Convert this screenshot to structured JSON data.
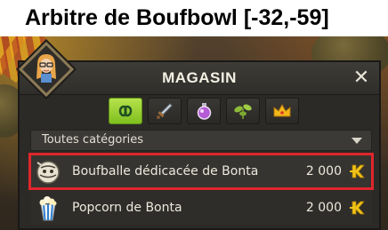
{
  "map": {
    "title": "Arbitre de Boufbowl [-32,-59]"
  },
  "shop": {
    "title": "MAGASIN",
    "close_label": "✕",
    "tabs": [
      {
        "name": "all-categories",
        "icon": "infinity-icon",
        "active": true
      },
      {
        "name": "weapons",
        "icon": "sword-icon",
        "active": false
      },
      {
        "name": "consumables",
        "icon": "potion-icon",
        "active": false
      },
      {
        "name": "resources",
        "icon": "plant-icon",
        "active": false
      },
      {
        "name": "cosmetics",
        "icon": "crown-icon",
        "active": false
      }
    ],
    "category_select": {
      "selected": "Toutes catégories"
    },
    "items": [
      {
        "name": "Boufballe dédicacée de Bonta",
        "price": "2 000",
        "icon": "ball-icon",
        "highlighted": true
      },
      {
        "name": "Popcorn de Bonta",
        "price": "2 000",
        "icon": "popcorn-icon",
        "highlighted": false
      }
    ],
    "currency_icon": "kama-icon"
  },
  "colors": {
    "active_tab": "#8fce2a",
    "highlight_outline": "#e0262c",
    "kama": "#f2c318",
    "window_bg": "#2b2a27"
  }
}
